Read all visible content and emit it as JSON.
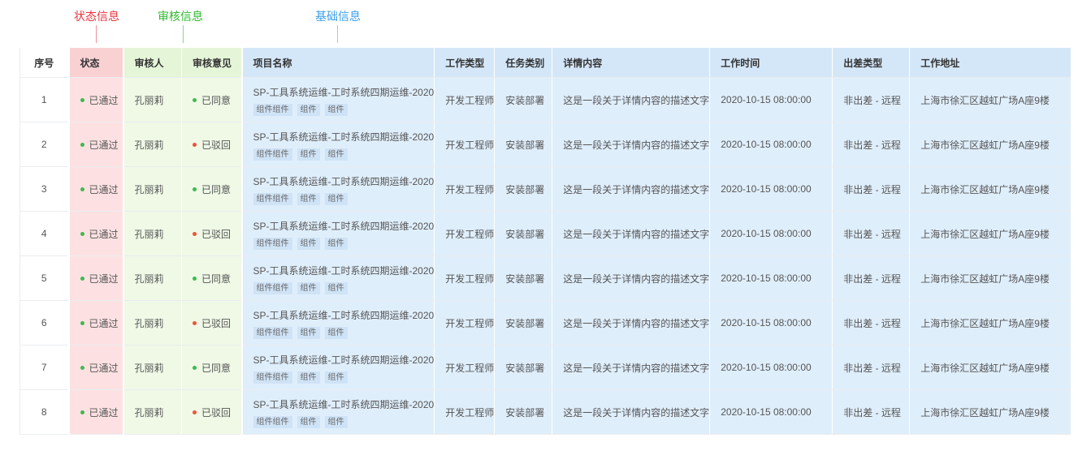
{
  "annotations": {
    "status_group": "状态信息",
    "review_group": "审核信息",
    "basic_group": "基础信息"
  },
  "colors": {
    "approved_dot": "#3fb950",
    "rejected_dot": "#f0533c"
  },
  "headers": [
    "序号",
    "状态",
    "审核人",
    "审核意见",
    "项目名称",
    "工作类型",
    "任务类别",
    "详情内容",
    "工作时间",
    "出差类型",
    "工作地址"
  ],
  "rows": [
    {
      "idx": "1",
      "status": "已通过",
      "reviewer": "孔丽莉",
      "opinion": "已同意",
      "opinion_type": "approved",
      "project": "SP-工具系统运维-工时系统四期运维-2020",
      "tags": [
        "组件组件",
        "组件",
        "组件"
      ],
      "work_type": "开发工程师",
      "task_type": "安装部署",
      "detail": "这是一段关于详情内容的描述文字",
      "time": "2020-10-15 08:00:00",
      "trip": "非出差 - 远程",
      "address": "上海市徐汇区越虹广场A座9楼"
    },
    {
      "idx": "2",
      "status": "已通过",
      "reviewer": "孔丽莉",
      "opinion": "已驳回",
      "opinion_type": "rejected",
      "project": "SP-工具系统运维-工时系统四期运维-2020",
      "tags": [
        "组件组件",
        "组件",
        "组件"
      ],
      "work_type": "开发工程师",
      "task_type": "安装部署",
      "detail": "这是一段关于详情内容的描述文字",
      "time": "2020-10-15 08:00:00",
      "trip": "非出差 - 远程",
      "address": "上海市徐汇区越虹广场A座9楼"
    },
    {
      "idx": "3",
      "status": "已通过",
      "reviewer": "孔丽莉",
      "opinion": "已同意",
      "opinion_type": "approved",
      "project": "SP-工具系统运维-工时系统四期运维-2020",
      "tags": [
        "组件组件",
        "组件",
        "组件"
      ],
      "work_type": "开发工程师",
      "task_type": "安装部署",
      "detail": "这是一段关于详情内容的描述文字",
      "time": "2020-10-15 08:00:00",
      "trip": "非出差 - 远程",
      "address": "上海市徐汇区越虹广场A座9楼"
    },
    {
      "idx": "4",
      "status": "已通过",
      "reviewer": "孔丽莉",
      "opinion": "已驳回",
      "opinion_type": "rejected",
      "project": "SP-工具系统运维-工时系统四期运维-2020",
      "tags": [
        "组件组件",
        "组件",
        "组件"
      ],
      "work_type": "开发工程师",
      "task_type": "安装部署",
      "detail": "这是一段关于详情内容的描述文字",
      "time": "2020-10-15 08:00:00",
      "trip": "非出差 - 远程",
      "address": "上海市徐汇区越虹广场A座9楼"
    },
    {
      "idx": "5",
      "status": "已通过",
      "reviewer": "孔丽莉",
      "opinion": "已同意",
      "opinion_type": "approved",
      "project": "SP-工具系统运维-工时系统四期运维-2020",
      "tags": [
        "组件组件",
        "组件",
        "组件"
      ],
      "work_type": "开发工程师",
      "task_type": "安装部署",
      "detail": "这是一段关于详情内容的描述文字",
      "time": "2020-10-15 08:00:00",
      "trip": "非出差 - 远程",
      "address": "上海市徐汇区越虹广场A座9楼"
    },
    {
      "idx": "6",
      "status": "已通过",
      "reviewer": "孔丽莉",
      "opinion": "已驳回",
      "opinion_type": "rejected",
      "project": "SP-工具系统运维-工时系统四期运维-2020",
      "tags": [
        "组件组件",
        "组件",
        "组件"
      ],
      "work_type": "开发工程师",
      "task_type": "安装部署",
      "detail": "这是一段关于详情内容的描述文字",
      "time": "2020-10-15 08:00:00",
      "trip": "非出差 - 远程",
      "address": "上海市徐汇区越虹广场A座9楼"
    },
    {
      "idx": "7",
      "status": "已通过",
      "reviewer": "孔丽莉",
      "opinion": "已同意",
      "opinion_type": "approved",
      "project": "SP-工具系统运维-工时系统四期运维-2020",
      "tags": [
        "组件组件",
        "组件",
        "组件"
      ],
      "work_type": "开发工程师",
      "task_type": "安装部署",
      "detail": "这是一段关于详情内容的描述文字",
      "time": "2020-10-15 08:00:00",
      "trip": "非出差 - 远程",
      "address": "上海市徐汇区越虹广场A座9楼"
    },
    {
      "idx": "8",
      "status": "已通过",
      "reviewer": "孔丽莉",
      "opinion": "已驳回",
      "opinion_type": "rejected",
      "project": "SP-工具系统运维-工时系统四期运维-2020",
      "tags": [
        "组件组件",
        "组件",
        "组件"
      ],
      "work_type": "开发工程师",
      "task_type": "安装部署",
      "detail": "这是一段关于详情内容的描述文字",
      "time": "2020-10-15 08:00:00",
      "trip": "非出差 - 远程",
      "address": "上海市徐汇区越虹广场A座9楼"
    }
  ]
}
